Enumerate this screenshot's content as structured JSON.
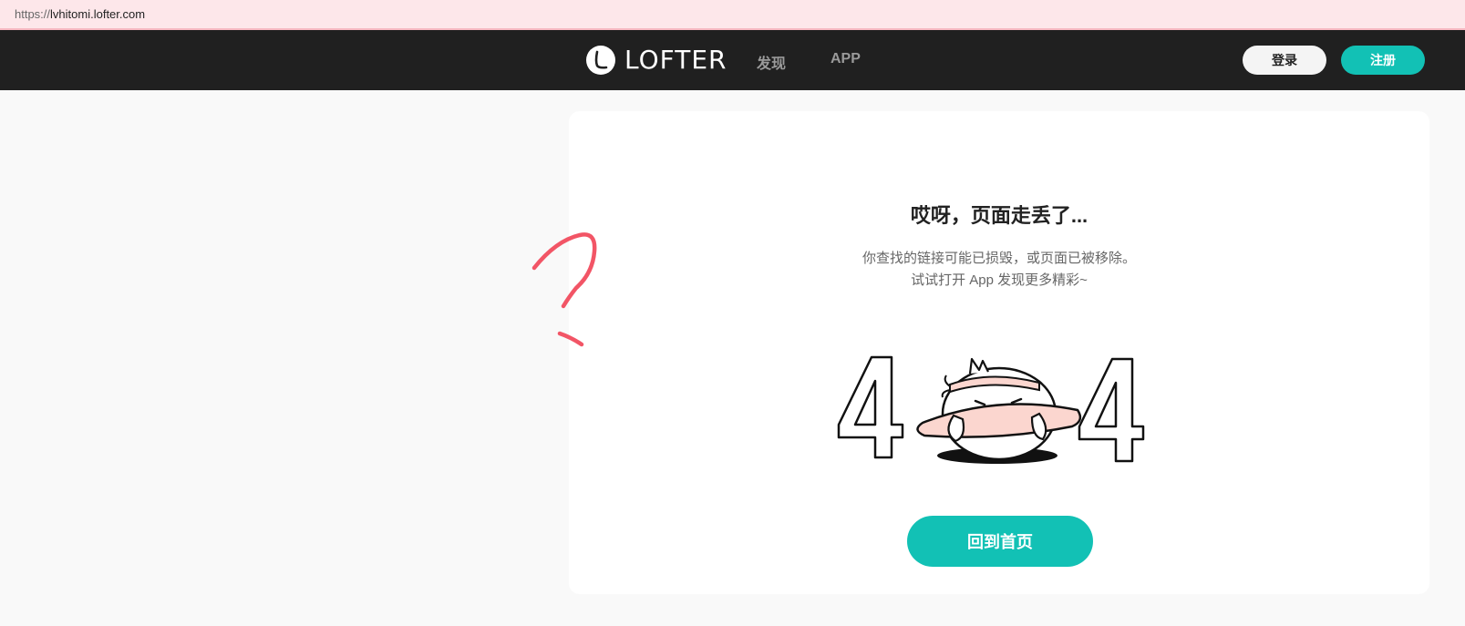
{
  "browser": {
    "url_scheme": "https://",
    "url_host": "lvhitomi.lofter.com"
  },
  "nav": {
    "logo_text": "LOFTER",
    "links": [
      {
        "label": "发现"
      },
      {
        "label": "APP"
      }
    ],
    "login_label": "登录",
    "register_label": "注册"
  },
  "error": {
    "title": "哎呀，页面走丢了...",
    "desc_line1": "你查找的链接可能已损毁，或页面已被移除。",
    "desc_line2": "试试打开 App 发现更多精彩~",
    "home_button": "回到首页"
  },
  "colors": {
    "accent": "#12c1b5",
    "nav_bg": "#202020",
    "annotation": "#f25566"
  },
  "icons": {
    "logo": "lofter-logo-icon",
    "illustration": "404-chick-illustration",
    "annotation": "question-mark-doodle"
  }
}
